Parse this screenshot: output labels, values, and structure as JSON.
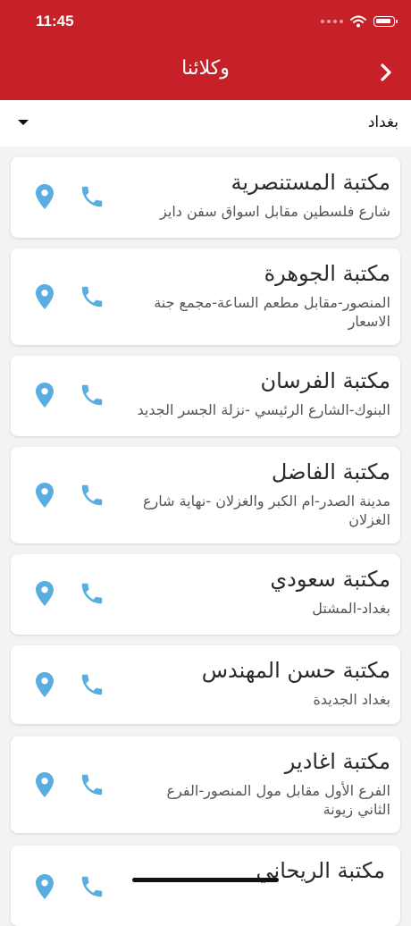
{
  "status_bar": {
    "time": "11:45"
  },
  "header": {
    "title": "وكلائنا",
    "back_icon": "chevron-right-icon"
  },
  "filter": {
    "city": "بغداد"
  },
  "colors": {
    "brand": "#c62128",
    "icon": "#5aade1"
  },
  "agents": [
    {
      "name": "مكتبة المستنصرية",
      "address": "شارع فلسطين مقابل اسواق سفن دايز"
    },
    {
      "name": "مكتبة الجوهرة",
      "address": "المنصور-مقابل مطعم الساعة-مجمع جنة الاسعار"
    },
    {
      "name": "مكتبة الفرسان",
      "address": "البنوك-الشارع الرئيسي -نزلة الجسر الجديد"
    },
    {
      "name": "مكتبة الفاضل",
      "address": "مدينة الصدر-ام الكبر والغزلان -نهاية شارع الغزلان"
    },
    {
      "name": "مكتبة سعودي",
      "address": "بغداد-المشتل"
    },
    {
      "name": "مكتبة حسن المهندس",
      "address": "بغداد الجديدة"
    },
    {
      "name": "مكتبة اغادير",
      "address": "الفرع الأول مقابل مول المنصور-الفرع الثاني زيونة"
    },
    {
      "name": "مكتبة الريحاني",
      "address": ""
    }
  ]
}
